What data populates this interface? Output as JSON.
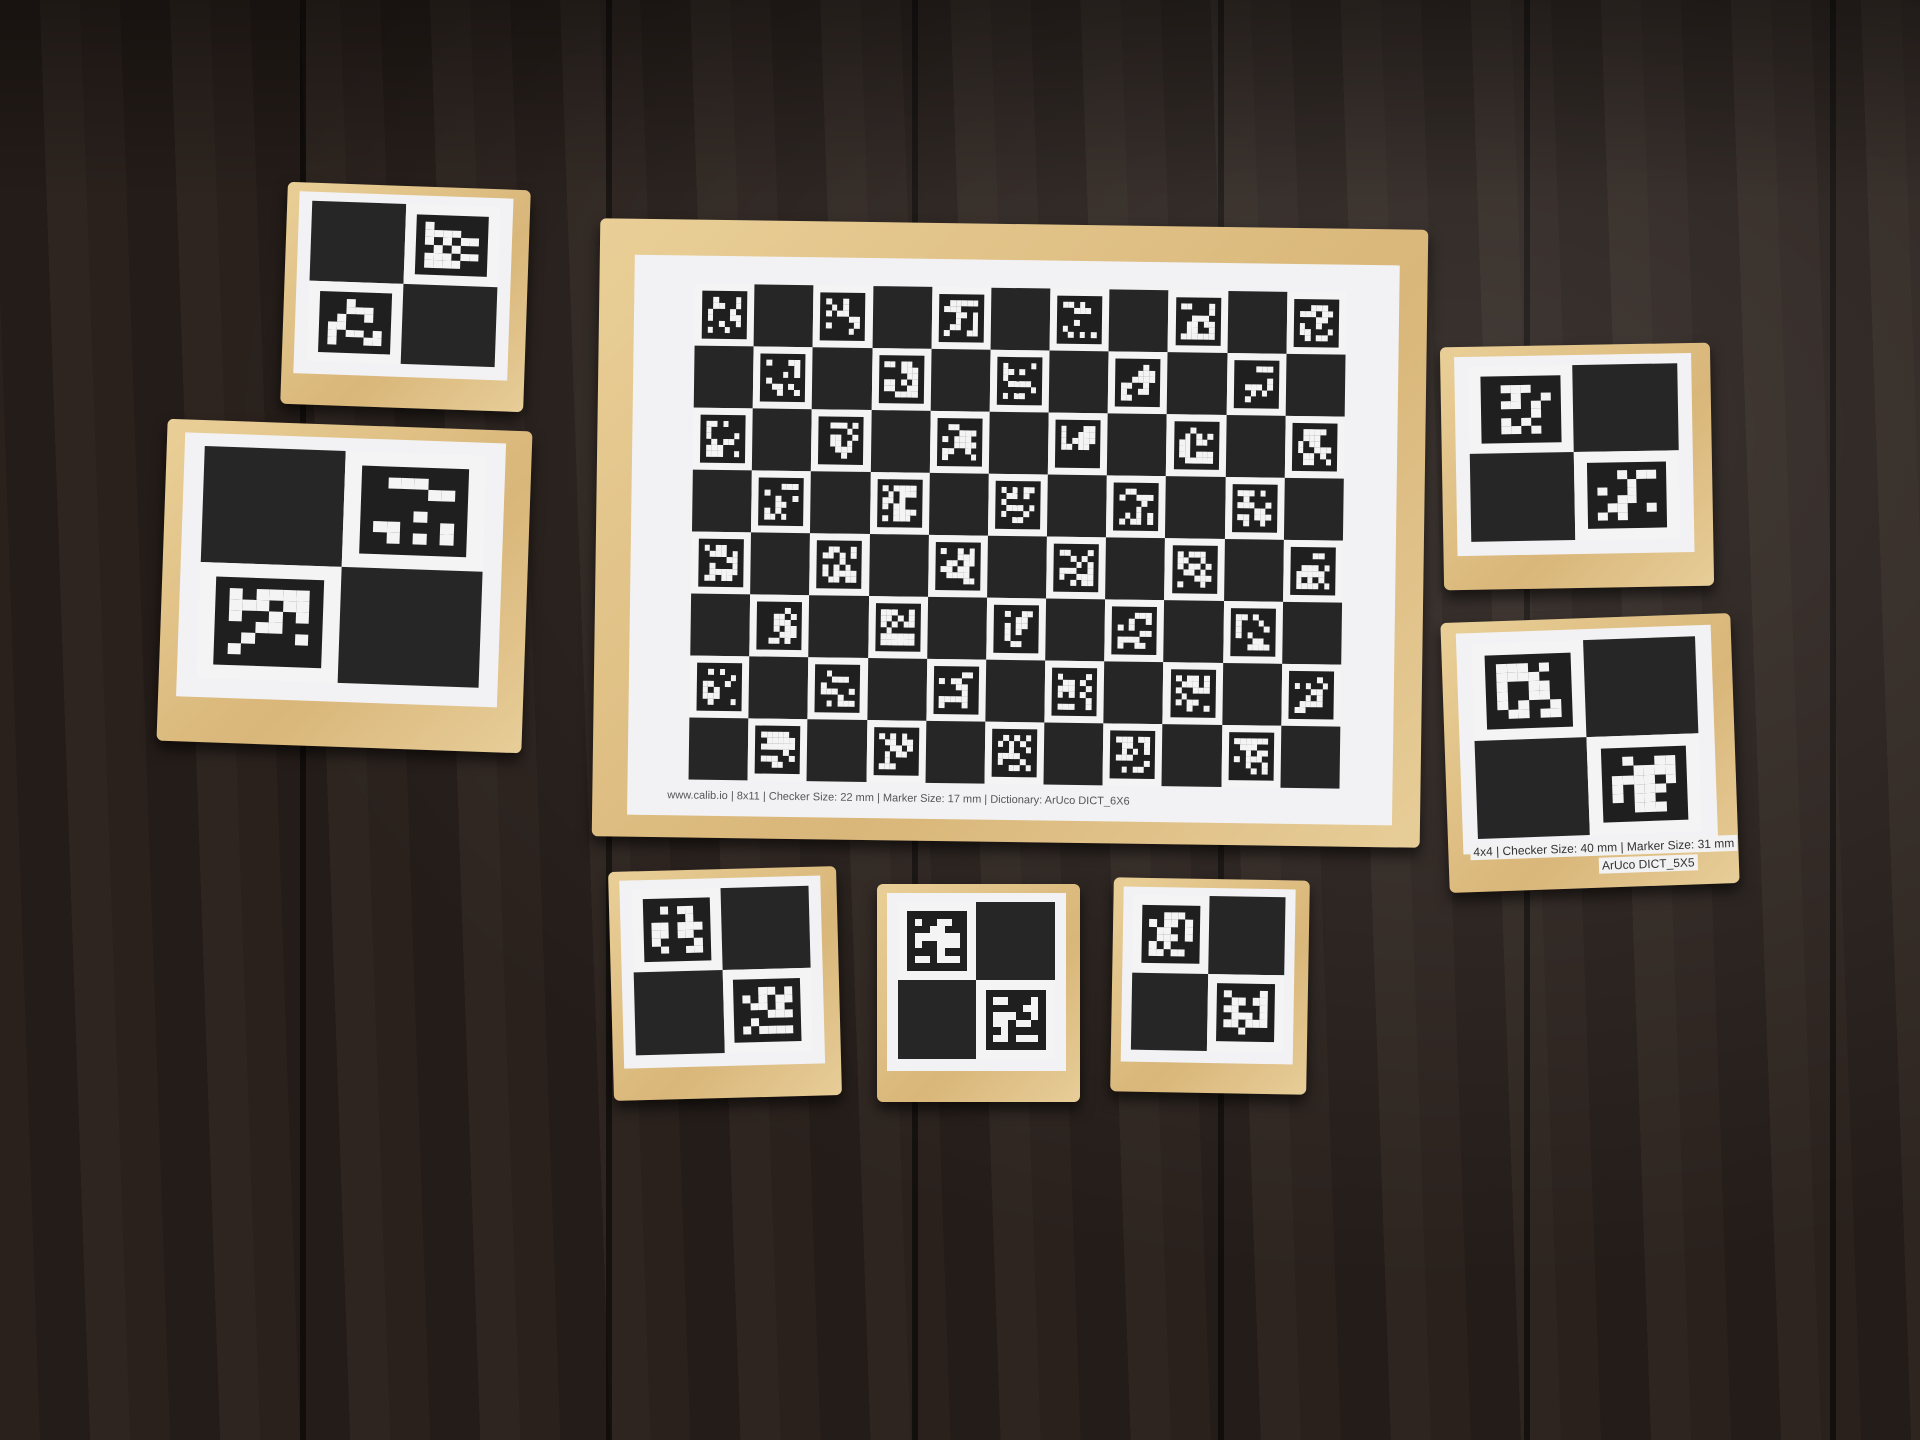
{
  "scene": {
    "description_type": "photo",
    "main_board": {
      "rows": 8,
      "cols": 11,
      "caption": "www.calib.io | 8x11 | Checker Size: 22 mm | Marker Size: 17 mm | Dictionary: ArUco DICT_6X6"
    },
    "small_boards": [
      {
        "pattern": "black-first"
      },
      {
        "pattern": "black-first"
      },
      {
        "pattern": "marker-first"
      },
      {
        "pattern": "marker-first",
        "label_line1": "4x4 | Checker Size: 40 mm | Marker Size: 31 mm",
        "label_line2": "ArUco DICT_5X5"
      },
      {
        "pattern": "marker-first"
      },
      {
        "pattern": "marker-first"
      },
      {
        "pattern": "marker-first"
      }
    ],
    "colors": {
      "floor": "#261e1a",
      "wood": "#e0c186",
      "black_square": "#262626",
      "paper": "#f2f2f4"
    }
  }
}
